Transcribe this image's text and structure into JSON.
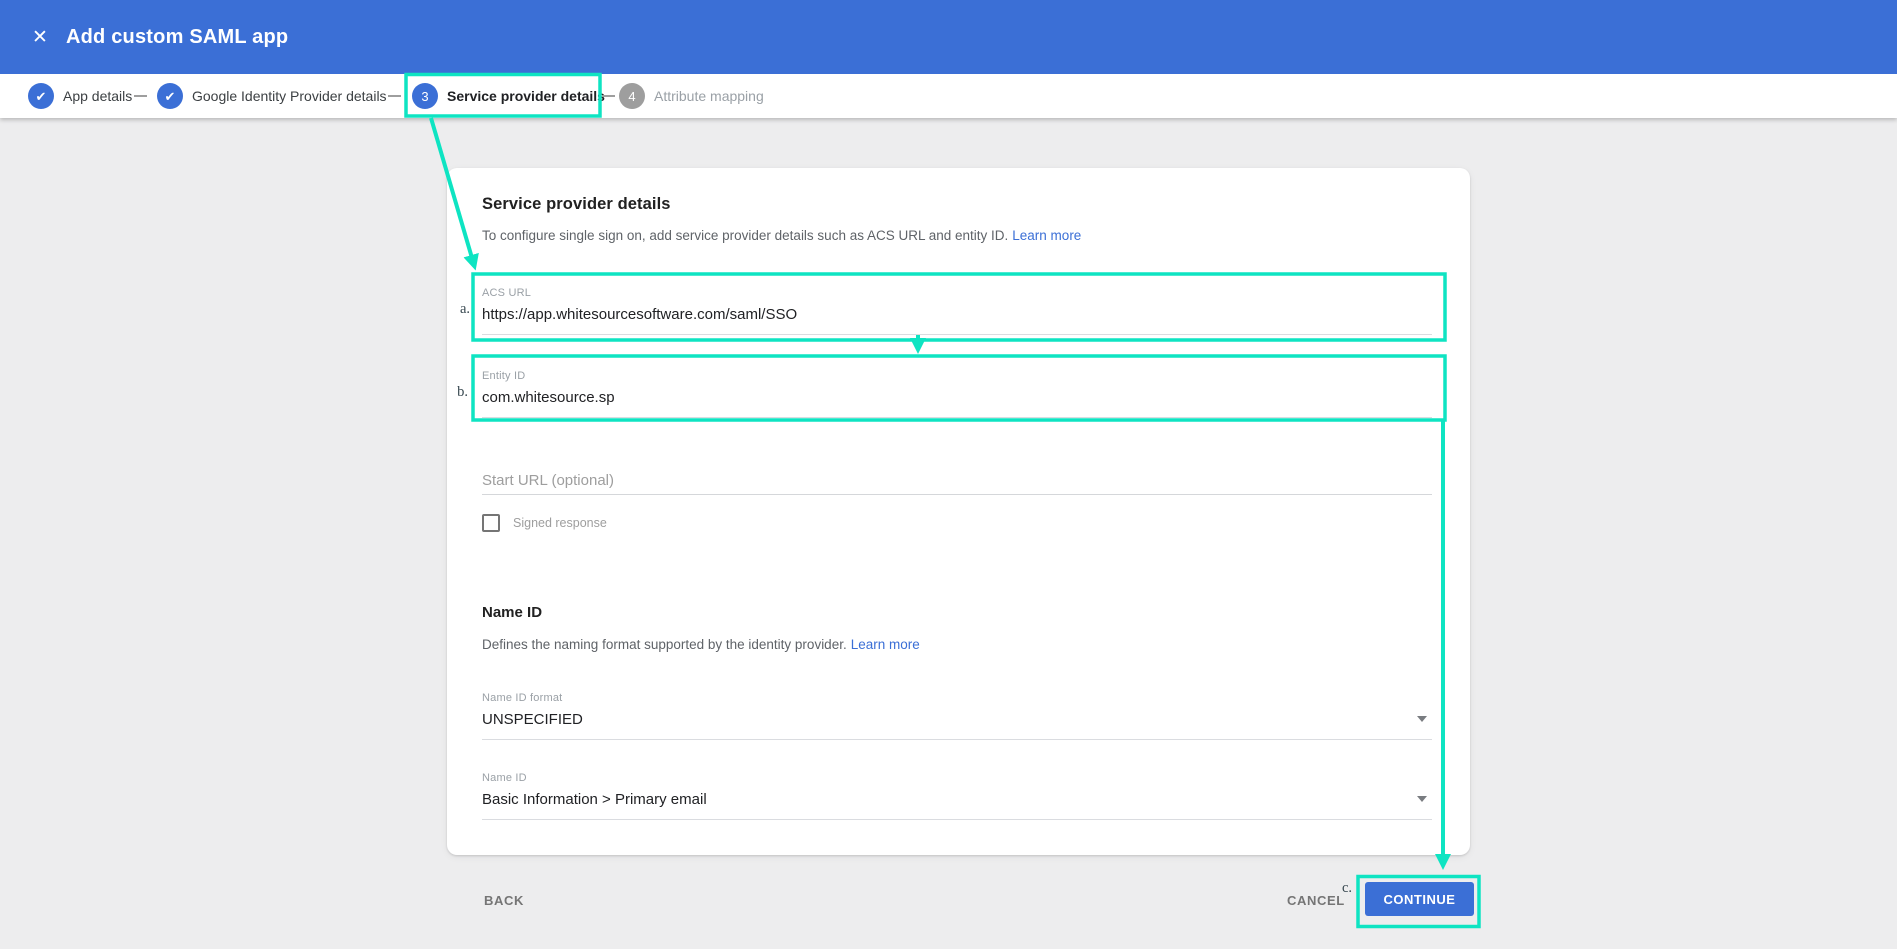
{
  "header": {
    "title": "Add custom SAML app"
  },
  "icons": {
    "close": "✕",
    "check": "✔"
  },
  "stepper": {
    "steps": [
      {
        "label": "App details",
        "state": "complete"
      },
      {
        "label": "Google Identity Provider details",
        "state": "complete"
      },
      {
        "number": "3",
        "label": "Service provider details",
        "state": "active",
        "highlighted": true
      },
      {
        "number": "4",
        "label": "Attribute mapping",
        "state": "upcoming"
      }
    ]
  },
  "form": {
    "title": "Service provider details",
    "description": "To configure single sign on, add service provider details such as ACS URL and entity ID.",
    "learn_more": "Learn more",
    "acs_url": {
      "label": "ACS URL",
      "value": "https://app.whitesourcesoftware.com/saml/SSO"
    },
    "entity_id": {
      "label": "Entity ID",
      "value": "com.whitesource.sp"
    },
    "start_url": {
      "placeholder": "Start URL (optional)"
    },
    "signed_response": {
      "label": "Signed response",
      "checked": false
    },
    "name_id_section": {
      "title": "Name ID",
      "description": "Defines the naming format supported by the identity provider.",
      "learn_more": "Learn more",
      "format_field": {
        "label": "Name ID format",
        "value": "UNSPECIFIED"
      },
      "name_id_field": {
        "label": "Name ID",
        "value": "Basic Information > Primary email"
      }
    }
  },
  "footer": {
    "back": "BACK",
    "cancel": "CANCEL",
    "continue": "CONTINUE"
  },
  "annotations": {
    "a": "a.",
    "b": "b.",
    "c": "c."
  },
  "colors": {
    "accent_blue": "#3b6fd6",
    "annotation_teal": "#0ee4c2",
    "inactive_gray": "#9e9e9e"
  }
}
